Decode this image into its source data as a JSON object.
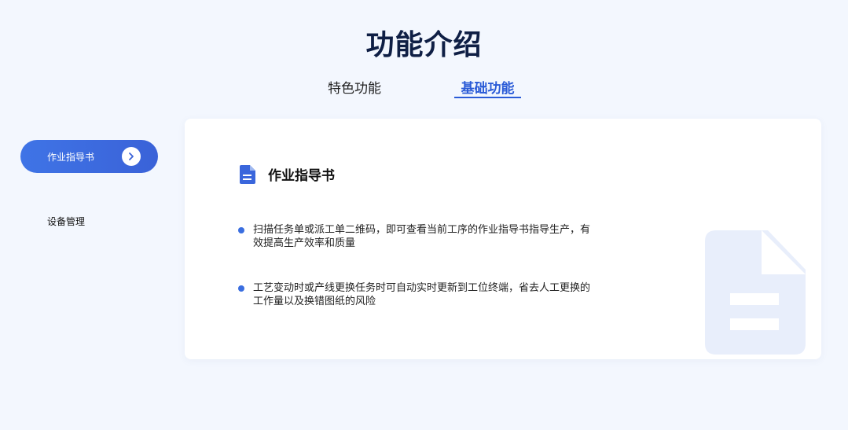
{
  "page": {
    "title": "功能介绍"
  },
  "tabs": [
    {
      "label": "特色功能",
      "active": false
    },
    {
      "label": "基础功能",
      "active": true
    }
  ],
  "sidebar": {
    "items": [
      {
        "label": "作业指导书",
        "active": true,
        "icon": "chevron-right-icon"
      },
      {
        "label": "设备管理",
        "active": false
      }
    ]
  },
  "card": {
    "icon": "document-icon",
    "title": "作业指导书",
    "bullets": [
      {
        "line1": "扫描任务单或派工单二维码，即可查看当前工序的作业指导书指导生产，有",
        "line2": "效提高生产效率和质量"
      },
      {
        "line1": "工艺变动时或产线更换任务时可自动实时更新到工位终端，省去人工更换的",
        "line2": "工作量以及换错图纸的风险"
      }
    ],
    "background_icon": "document-watermark-icon"
  },
  "colors": {
    "accent": "#2a5bd7",
    "page_background": "#f3f7fe",
    "title": "#0f1f45",
    "watermark": "#e8eefb"
  }
}
